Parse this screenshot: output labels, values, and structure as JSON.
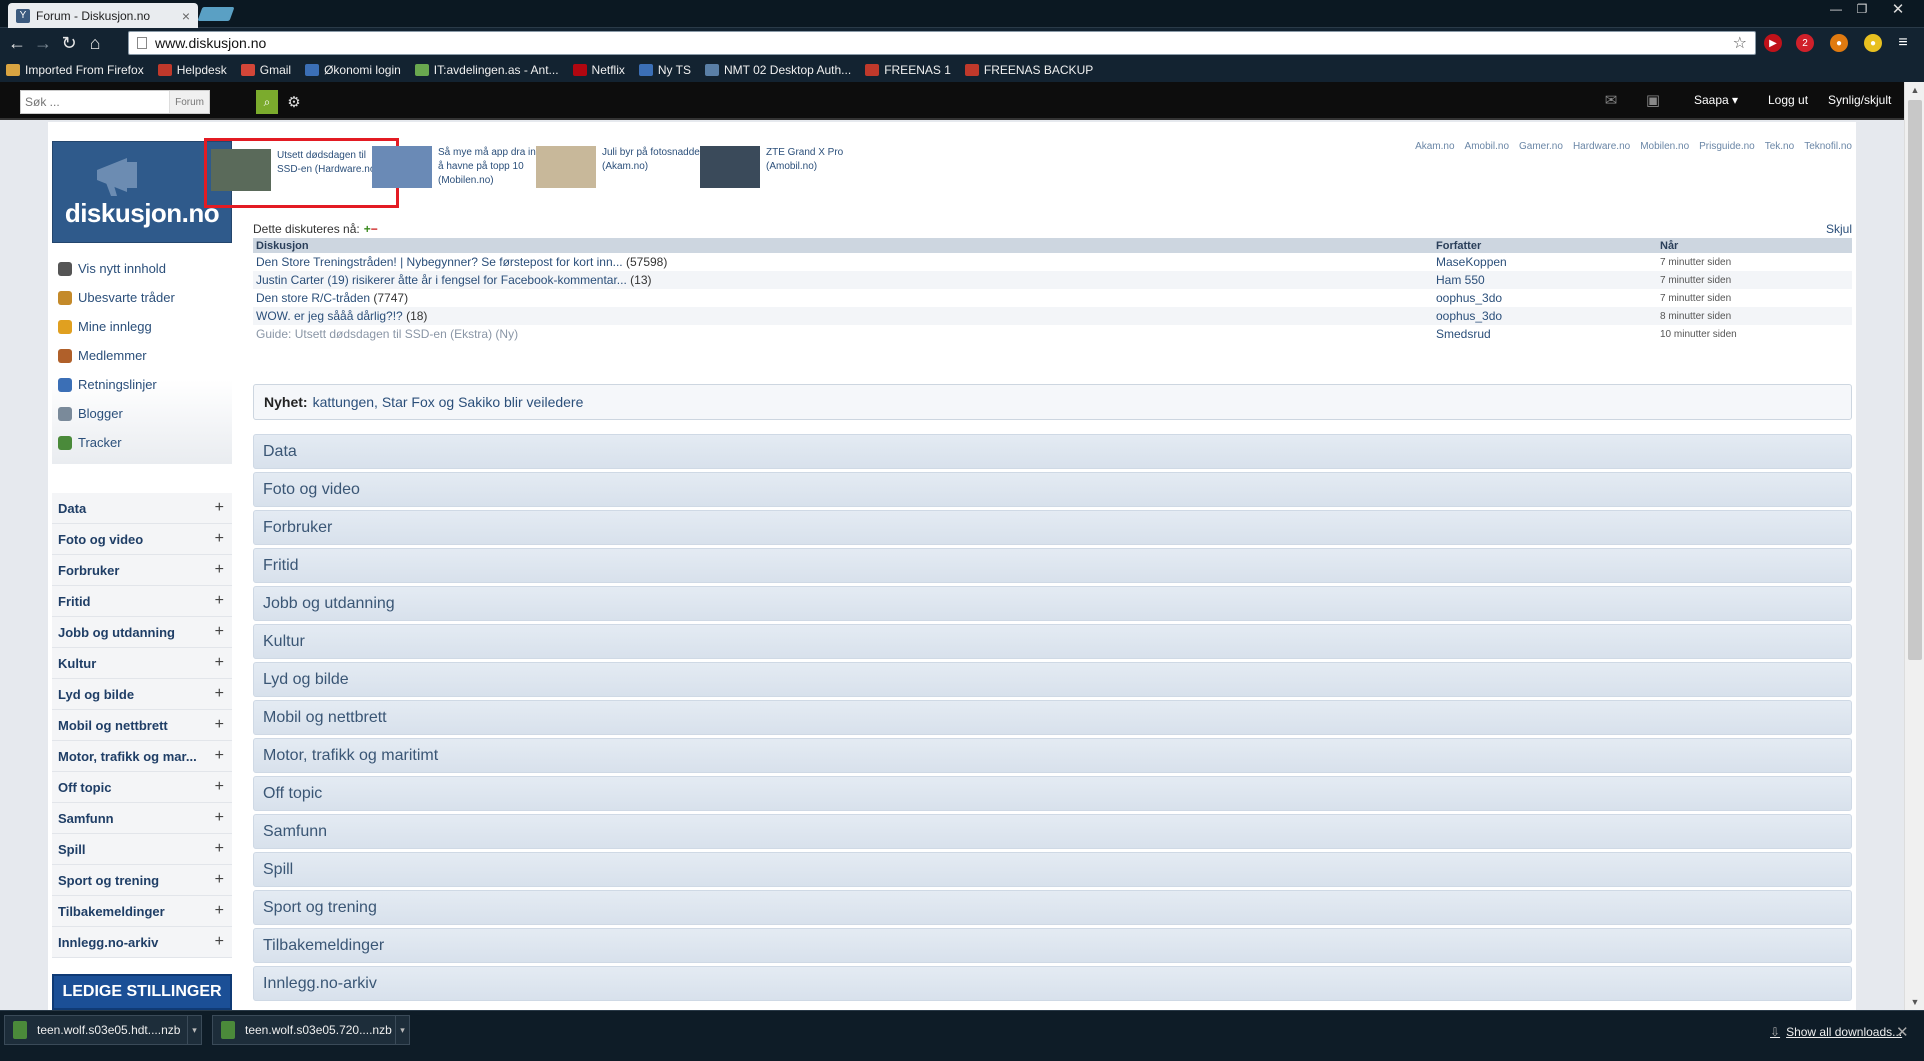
{
  "browser": {
    "tab_title": "Forum - Diskusjon.no",
    "url": "www.diskusjon.no",
    "bookmarks": [
      {
        "label": "Imported From Firefox",
        "color": "#d9a441"
      },
      {
        "label": "Helpdesk",
        "color": "#c0392b"
      },
      {
        "label": "Gmail",
        "color": "#d44638"
      },
      {
        "label": "Økonomi login",
        "color": "#3b6fb6"
      },
      {
        "label": "IT:avdelingen.as - Ant...",
        "color": "#6aa84f"
      },
      {
        "label": "Netflix",
        "color": "#b20710"
      },
      {
        "label": "Ny TS",
        "color": "#3b6fb6"
      },
      {
        "label": "NMT 02 Desktop Auth...",
        "color": "#5a7fa6"
      },
      {
        "label": "FREENAS 1",
        "color": "#c0392b"
      },
      {
        "label": "FREENAS BACKUP",
        "color": "#c0392b"
      }
    ],
    "extension_badge": "2"
  },
  "sitebar": {
    "search_placeholder": "Søk ...",
    "search_scope": "Forum",
    "user": "Saapa",
    "logout": "Logg ut",
    "visibility": "Synlig/skjult"
  },
  "logo": {
    "brand": "diskusjon.no"
  },
  "quicklinks": [
    {
      "label": "Vis nytt innhold",
      "color": "#555"
    },
    {
      "label": "Ubesvarte tråder",
      "color": "#c48a2a"
    },
    {
      "label": "Mine innlegg",
      "color": "#e0a020"
    },
    {
      "label": "Medlemmer",
      "color": "#b0602a"
    },
    {
      "label": "Retningslinjer",
      "color": "#3b6fb6"
    },
    {
      "label": "Blogger",
      "color": "#7a8a9a"
    },
    {
      "label": "Tracker",
      "color": "#4a8a3a"
    }
  ],
  "categories": [
    "Data",
    "Foto og video",
    "Forbruker",
    "Fritid",
    "Jobb og utdanning",
    "Kultur",
    "Lyd og bilde",
    "Mobil og nettbrett",
    "Motor, trafikk og mar...",
    "Off topic",
    "Samfunn",
    "Spill",
    "Sport og trening",
    "Tilbakemeldinger",
    "Innlegg.no-arkiv"
  ],
  "jobs_banner": "LEDIGE STILLINGER",
  "promos": [
    {
      "text": "Utsett dødsdagen til SSD-en (Hardware.no)",
      "thumb": "#5a6a5a"
    },
    {
      "text": "Så mye må app dra inn for å havne på topp 10 (Mobilen.no)",
      "thumb": "#6a8ab6"
    },
    {
      "text": "Juli byr på fotosnadder (Akam.no)",
      "thumb": "#c8b89a"
    },
    {
      "text": "ZTE Grand X Pro (Amobil.no)",
      "thumb": "#3a4a5a"
    }
  ],
  "network": [
    "Akam.no",
    "Amobil.no",
    "Gamer.no",
    "Hardware.no",
    "Mobilen.no",
    "Prisguide.no",
    "Tek.no",
    "Teknofil.no"
  ],
  "discussed": {
    "label": "Dette diskuteres nå:",
    "hide": "Skjul",
    "headers": {
      "topic": "Diskusjon",
      "author": "Forfatter",
      "when": "Når"
    },
    "rows": [
      {
        "title": "Den Store Treningstråden! | Nybegynner? Se førstepost for kort inn...",
        "count": "(57598)",
        "author": "MaseKoppen",
        "when": "7 minutter siden"
      },
      {
        "title": "Justin Carter (19) risikerer åtte år i fengsel for Facebook-kommentar...",
        "count": "(13)",
        "author": "Ham 550",
        "when": "7 minutter siden"
      },
      {
        "title": "Den store R/C-tråden",
        "count": "(7747)",
        "author": "oophus_3do",
        "when": "7 minutter siden"
      },
      {
        "title": "WOW. er jeg sååå dårlig?!?",
        "count": "(18)",
        "author": "oophus_3do",
        "when": "8 minutter siden"
      },
      {
        "title": "Guide: Utsett dødsdagen til SSD-en (Ekstra) (Ny)",
        "count": "",
        "author": "Smedsrud",
        "when": "10 minutter siden"
      }
    ]
  },
  "news": {
    "label": "Nyhet:",
    "text": "kattungen, Star Fox og Sakiko blir veiledere"
  },
  "forums": [
    "Data",
    "Foto og video",
    "Forbruker",
    "Fritid",
    "Jobb og utdanning",
    "Kultur",
    "Lyd og bilde",
    "Mobil og nettbrett",
    "Motor, trafikk og maritimt",
    "Off topic",
    "Samfunn",
    "Spill",
    "Sport og trening",
    "Tilbakemeldinger",
    "Innlegg.no-arkiv"
  ],
  "downloads": {
    "items": [
      "teen.wolf.s03e05.hdt....nzb",
      "teen.wolf.s03e05.720....nzb"
    ],
    "show_all": "Show all downloads..."
  }
}
